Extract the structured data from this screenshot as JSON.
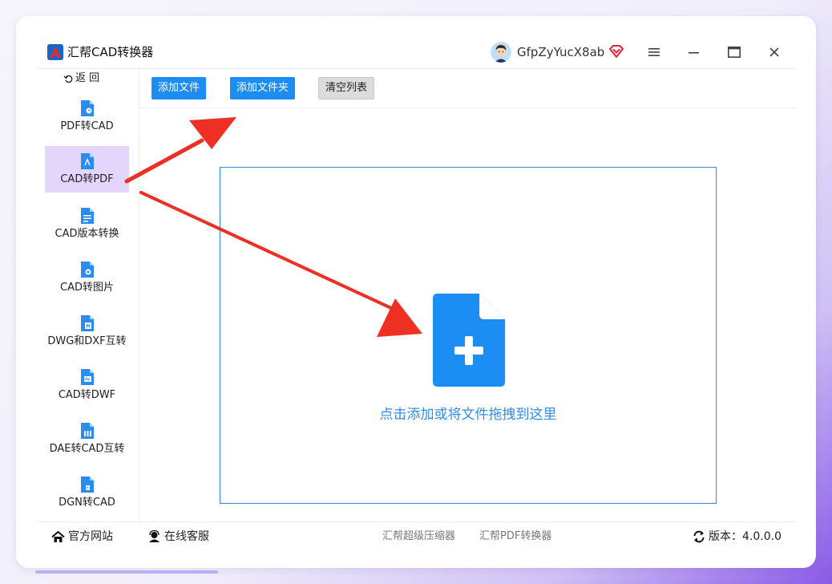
{
  "app": {
    "title": "汇帮CAD转换器",
    "username": "GfpZyYucX8ab",
    "accent_color": "#1c8ef3",
    "vip_color": "#e0253a"
  },
  "window_controls": {
    "menu_icon": "hamburger-icon",
    "minimize_icon": "minimize-icon",
    "maximize_icon": "maximize-icon",
    "close_icon": "close-icon"
  },
  "sidebar": {
    "back_label": "返 回",
    "items": [
      {
        "label": "PDF转CAD",
        "icon": "pdf-to-cad-icon",
        "active": false
      },
      {
        "label": "CAD转PDF",
        "icon": "cad-to-pdf-icon",
        "active": true
      },
      {
        "label": "CAD版本转换",
        "icon": "cad-version-icon",
        "active": false
      },
      {
        "label": "CAD转图片",
        "icon": "cad-to-image-icon",
        "active": false
      },
      {
        "label": "DWG和DXF互转",
        "icon": "dwg-dxf-icon",
        "active": false
      },
      {
        "label": "CAD转DWF",
        "icon": "cad-to-dwf-icon",
        "active": false
      },
      {
        "label": "DAE转CAD互转",
        "icon": "dae-cad-icon",
        "active": false
      },
      {
        "label": "DGN转CAD",
        "icon": "dgn-to-cad-icon",
        "active": false
      }
    ]
  },
  "toolbar": {
    "add_file": "添加文件",
    "add_folder": "添加文件夹",
    "clear_list": "清空列表"
  },
  "drop_zone": {
    "text": "点击添加或将文件拖拽到这里",
    "icon": "file-add-icon"
  },
  "statusbar": {
    "website": "官方网站",
    "support": "在线客服",
    "link1": "汇帮超级压缩器",
    "link2": "汇帮PDF转换器",
    "version": "版本：4.0.0.0"
  }
}
